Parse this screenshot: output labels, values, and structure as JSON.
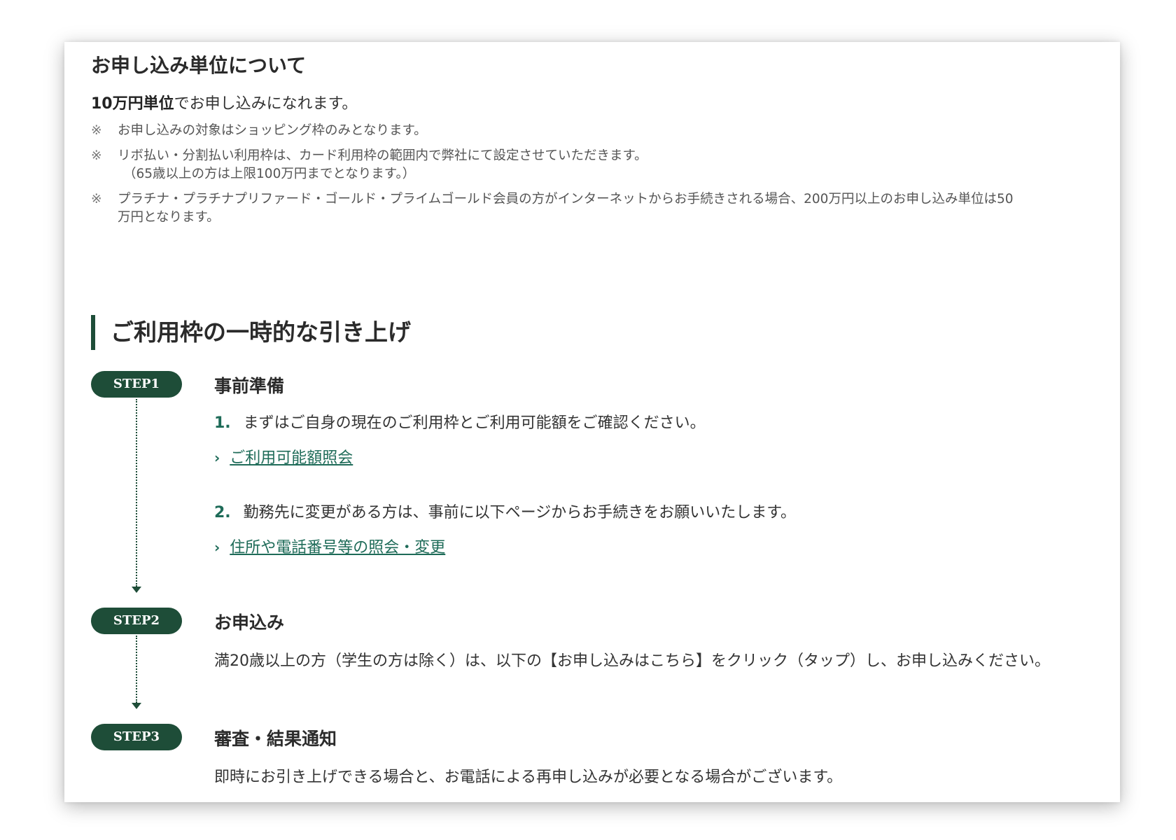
{
  "unit_section": {
    "title": "お申し込み単位について",
    "unit_bold": "10万円単位",
    "unit_rest": "でお申し込みになれます。",
    "note_mark": "※",
    "notes": [
      {
        "line1": "お申し込みの対象はショッピング枠のみとなります。"
      },
      {
        "line1": "リボ払い・分割払い利用枠は、カード利用枠の範囲内で弊社にて設定させていただきます。",
        "line2": "（65歳以上の方は上限100万円までとなります。）"
      },
      {
        "line1": "プラチナ・プラチナプリファード・ゴールド・プライムゴールド会員の方がインターネットからお手続きされる場合、200万円以上のお申し込み単位は50",
        "line2": "万円となります。"
      }
    ]
  },
  "increase_section": {
    "heading": "ご利用枠の一時的な引き上げ",
    "steps": [
      {
        "label": "STEP1",
        "title": "事前準備",
        "items": [
          {
            "num": "1.",
            "text": "まずはご自身の現在のご利用枠とご利用可能額をご確認ください。",
            "link_icon": "chevron-right-icon",
            "link": "ご利用可能額照会"
          },
          {
            "num": "2.",
            "text": "勤務先に変更がある方は、事前に以下ページからお手続きをお願いいたします。",
            "link_icon": "chevron-right-icon",
            "link": "住所や電話番号等の照会・変更"
          }
        ]
      },
      {
        "label": "STEP2",
        "title": "お申込み",
        "text": "満20歳以上の方（学生の方は除く）は、以下の【お申し込みはこちら】をクリック（タップ）し、お申し込みください。"
      },
      {
        "label": "STEP3",
        "title": "審査・結果通知",
        "text": "即時にお引き上げできる場合と、お電話による再申し込みが必要となる場合がございます。"
      }
    ]
  },
  "colors": {
    "accent_green": "#1e4d38",
    "link_green": "#1e6b58"
  }
}
